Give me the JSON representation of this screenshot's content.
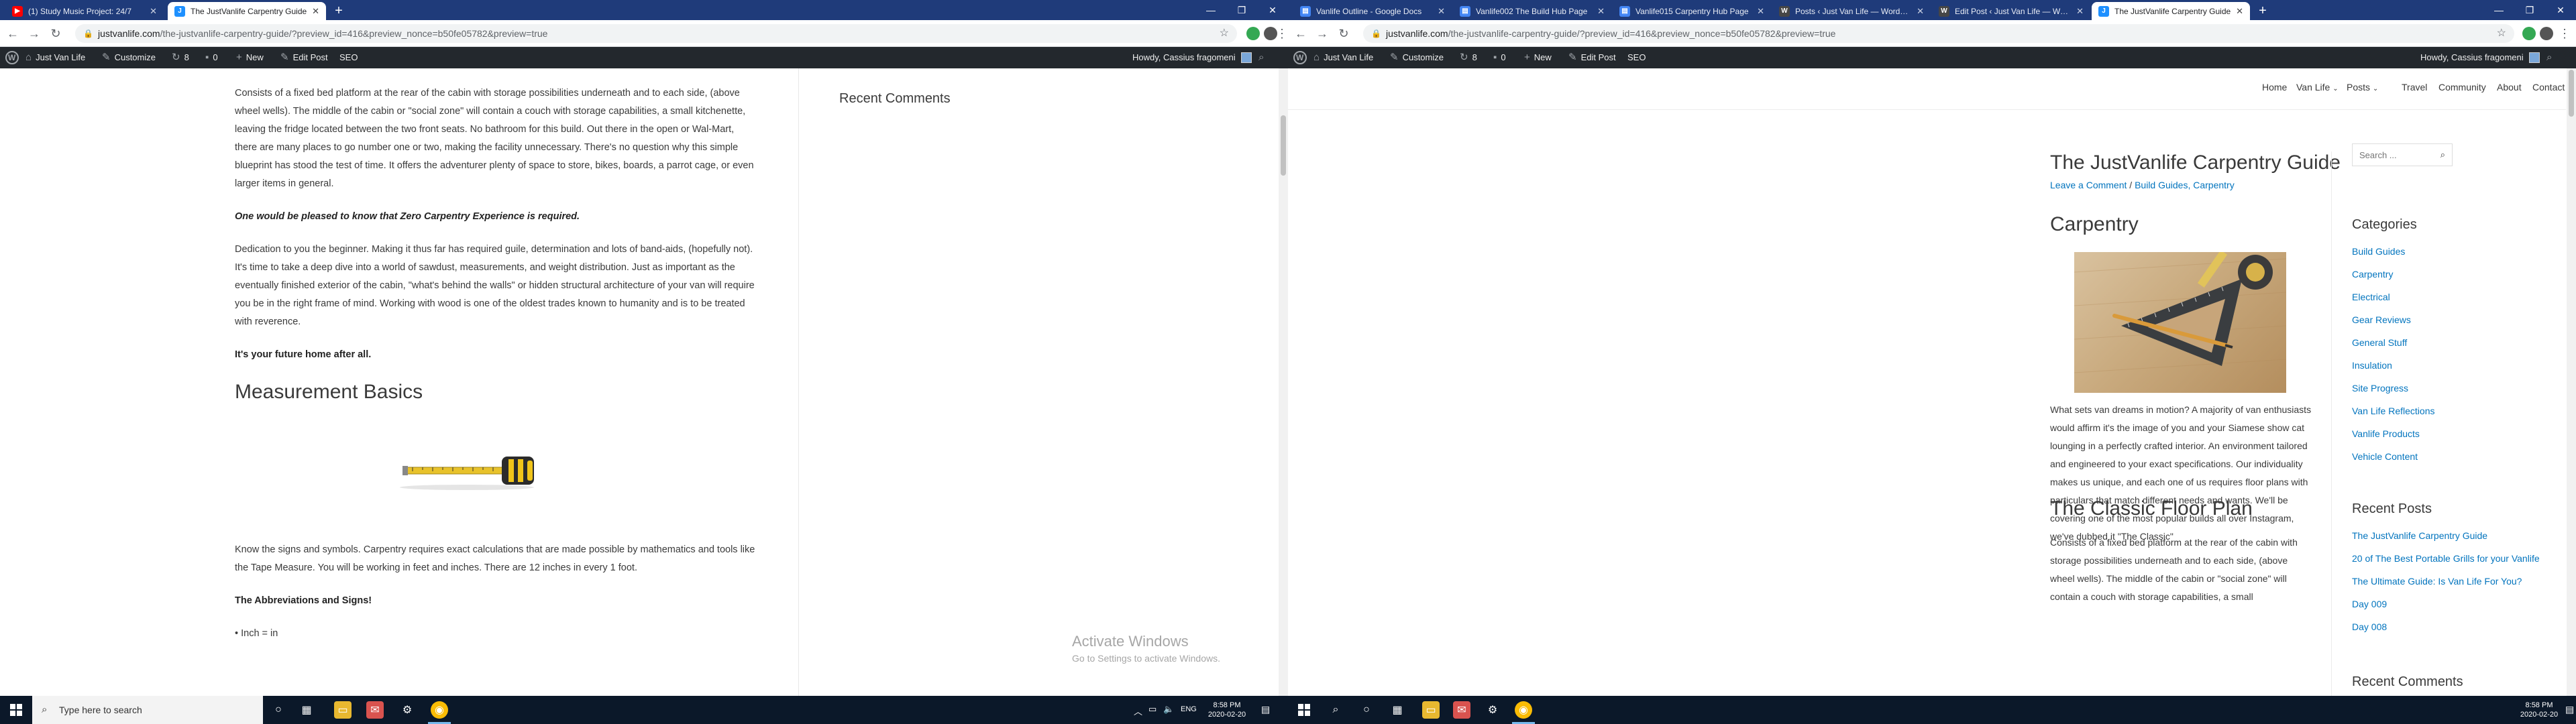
{
  "left": {
    "tabs": [
      {
        "title": "(1) Study Music Project: 24/7",
        "active": false,
        "color": "#ff0000"
      },
      {
        "title": "The JustVanlife Carpentry Guide",
        "active": true,
        "color": "#1e90ff"
      }
    ],
    "url": {
      "host": "justvanlife.com",
      "path": "/the-justvanlife-carpentry-guide/?preview_id=416&preview_nonce=b50fe05782&preview=true"
    },
    "adminbar": {
      "site": "Just Van Life",
      "customize": "Customize",
      "updates": "8",
      "comments": "0",
      "new": "New",
      "edit": "Edit Post",
      "seo": "SEO",
      "howdy": "Howdy, Cassius fragomeni"
    },
    "article": {
      "p1": "Consists of a fixed bed platform at the rear of the cabin with storage possibilities underneath and to each side, (above wheel wells). The middle of the cabin or \"social zone\" will contain a couch with storage capabilities, a small kitchenette, leaving the fridge located between the two front seats. No bathroom for this build. Out there in the open or Wal-Mart, there are many places to go number one or two, making the facility unnecessary. There's no question why this simple blueprint has stood the test of time. It offers the adventurer plenty of space to store, bikes, boards, a parrot cage, or even larger items in general.",
      "p2": "One would be pleased to know that Zero Carpentry Experience is required.",
      "p3": "Dedication to you the beginner. Making it thus far has required guile, determination and lots of band-aids, (hopefully not). It's time to take a deep dive into a world of sawdust, measurements, and weight distribution. Just as important as the eventually finished exterior of the cabin, \"what's behind the walls\" or hidden structural architecture of your van will require you be in the right frame of mind. Working with wood is one of the oldest trades known to humanity and is to be treated with reverence.",
      "p4": "It's your future home after all.",
      "h2": "Measurement Basics",
      "p5": "Know the signs and symbols. Carpentry requires exact calculations that are made possible by mathematics and tools like the Tape Measure. You will be working in feet and inches. There are 12 inches in every 1 foot.",
      "p6": "The Abbreviations and Signs!",
      "p7": "• Inch = in"
    },
    "sidebar_title": "Recent Comments",
    "activate": {
      "line1": "Activate Windows",
      "line2": "Go to Settings to activate Windows."
    },
    "taskbar": {
      "search": "Type here to search",
      "lang": "ENG",
      "time": "8:58 PM",
      "date": "2020-02-20"
    }
  },
  "right": {
    "tabs": [
      {
        "title": "Vanlife Outline - Google Docs",
        "color": "#4285f4"
      },
      {
        "title": "Vanlife002 The Build Hub Page",
        "color": "#4285f4"
      },
      {
        "title": "Vanlife015 Carpentry Hub Page",
        "color": "#4285f4"
      },
      {
        "title": "Posts ‹ Just Van Life — WordPress",
        "color": "#464646"
      },
      {
        "title": "Edit Post ‹ Just Van Life — WordPress",
        "color": "#464646"
      },
      {
        "title": "The JustVanlife Carpentry Guide",
        "color": "#1e90ff"
      }
    ],
    "url": {
      "host": "justvanlife.com",
      "path": "/the-justvanlife-carpentry-guide/?preview_id=416&preview_nonce=b50fe05782&preview=true"
    },
    "adminbar": {
      "site": "Just Van Life",
      "customize": "Customize",
      "updates": "8",
      "comments": "0",
      "new": "New",
      "edit": "Edit Post",
      "seo": "SEO",
      "howdy": "Howdy, Cassius fragomeni"
    },
    "nav": {
      "home": "Home",
      "vanlife": "Van Life",
      "posts": "Posts",
      "travel": "Travel",
      "community": "Community",
      "about": "About",
      "contact": "Contact"
    },
    "post": {
      "title": "The JustVanlife Carpentry Guide",
      "meta_comment": "Leave a Comment",
      "meta_cats": "Build Guides, Carpentry",
      "h2a": "Carpentry",
      "p1": "What sets van dreams in motion? A majority of van enthusiasts would affirm it's the image of you and your Siamese show cat lounging in a perfectly crafted interior. An environment tailored and engineered to your exact specifications. Our individuality makes us unique, and each one of us requires floor plans with particulars that match different needs and wants. We'll be covering one of the most popular builds all over Instagram, we've dubbed it \"The Classic\"",
      "h2b": "The Classic Floor Plan",
      "p2": "Consists of a fixed bed platform at the rear of the cabin with storage possibilities underneath and to each side, (above wheel wells). The middle of the cabin or \"social zone\" will contain a couch with storage capabilities, a small"
    },
    "sidebar": {
      "search_placeholder": "Search ...",
      "categories_title": "Categories",
      "categories": [
        "Build Guides",
        "Carpentry",
        "Electrical",
        "Gear Reviews",
        "General Stuff",
        "Insulation",
        "Site Progress",
        "Van Life Reflections",
        "Vanlife Products",
        "Vehicle Content"
      ],
      "recent_title": "Recent Posts",
      "recent": [
        "The JustVanlife Carpentry Guide",
        "20 of The Best Portable Grills for your Vanlife",
        "The Ultimate Guide: Is Van Life For You?",
        "Day 009",
        "Day 008"
      ],
      "comments_title": "Recent Comments"
    },
    "taskbar": {
      "time": "8:58 PM",
      "date": "2020-02-20"
    }
  },
  "colors": {
    "link": "#0274be",
    "tabstrip": "#1f3b7a",
    "adminbar": "#23282d",
    "taskbar": "#0b1829"
  }
}
